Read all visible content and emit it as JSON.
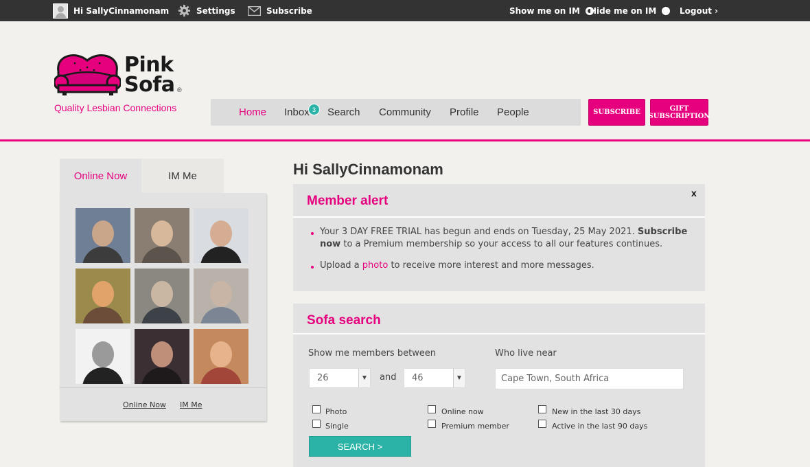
{
  "topbar": {
    "user_greeting": "Hi SallyCinnamonam",
    "settings_label": "Settings",
    "subscribe_label": "Subscribe",
    "show_on_im_label": "Show me on IM",
    "hide_on_im_label": "Hide me on IM",
    "im_selected": "Show me on IM",
    "logout_label": "Logout ›"
  },
  "brand": {
    "name_line1": "Pink",
    "name_line2": "Sofa",
    "registered_mark": "®",
    "tagline": "Quality Lesbian Connections",
    "accent_color": "#e6007e",
    "teal_color": "#2ab3a6"
  },
  "nav": {
    "items": [
      {
        "label": "Home",
        "active": true
      },
      {
        "label": "Inbox",
        "badge": "3"
      },
      {
        "label": "Search"
      },
      {
        "label": "Community"
      },
      {
        "label": "Profile"
      },
      {
        "label": "People"
      }
    ],
    "subscribe_button": "SUBSCRIBE",
    "gift_button_line1": "GIFT",
    "gift_button_line2": "SUBSCRIPTION"
  },
  "sidebar": {
    "tabs": [
      {
        "label": "Online Now",
        "active": true
      },
      {
        "label": "IM Me",
        "active": false
      }
    ],
    "member_photo_count": 9,
    "footer_links": [
      "Online Now",
      "IM Me"
    ]
  },
  "main": {
    "greeting": "Hi SallyCinnamonam",
    "alert": {
      "title": "Member alert",
      "close_label": "x",
      "trial_text": "Your 3 DAY FREE TRIAL has begun and ends on Tuesday, 25 May 2021.",
      "subscribe_link": "Subscribe now",
      "trial_text_2": "to a Premium membership so your access to all our features continues.",
      "upload_prefix": "Upload a",
      "photo_link": "photo",
      "upload_suffix": "to receive more interest and more messages."
    },
    "search": {
      "title": "Sofa search",
      "between_label": "Show me members between",
      "age_min": "26",
      "and_label": "and",
      "age_max": "46",
      "near_label": "Who live near",
      "location": "Cape Town, South Africa",
      "checkboxes": {
        "photo": "Photo",
        "single": "Single",
        "online_now": "Online now",
        "premium": "Premium member",
        "new_30": "New in the last 30 days",
        "active_90": "Active in the last 90 days"
      },
      "search_button": "SEARCH >"
    }
  }
}
